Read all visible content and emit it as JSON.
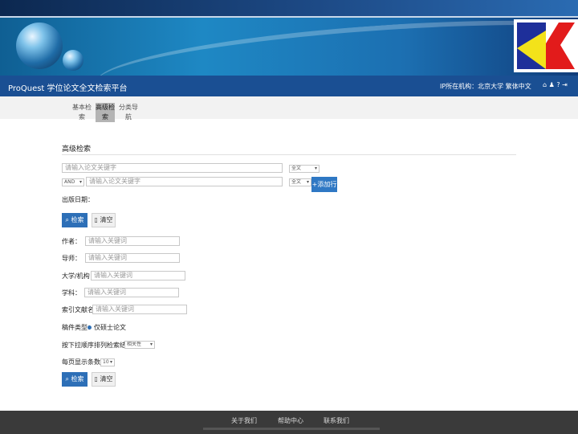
{
  "header": {
    "title": "ProQuest 学位论文全文检索平台",
    "institution": "IP所在机构：北京大学 繁体中文",
    "icons": [
      "home-icon",
      "user-icon",
      "help-icon",
      "exit-icon"
    ]
  },
  "tabs": [
    {
      "label": "基本检索",
      "active": false
    },
    {
      "label": "高级检索",
      "active": true
    },
    {
      "label": "分类导航",
      "active": false
    }
  ],
  "form": {
    "heading": "高级检索",
    "row1": {
      "placeholder": "请输入论文关键字",
      "field": "全文"
    },
    "row2": {
      "operator": "AND",
      "placeholder": "请输入论文关键字",
      "field": "全文"
    },
    "add_label": "+添加行",
    "pubdate_label": "出版日期：",
    "search_label": "检索",
    "clear_label": "清空",
    "fields": [
      {
        "label": "作者：",
        "placeholder": "请输入关键词"
      },
      {
        "label": "导师：",
        "placeholder": "请输入关键词"
      },
      {
        "label": "大学/机构：",
        "placeholder": "请输入关键词"
      },
      {
        "label": "学科：",
        "placeholder": "请输入关键词"
      },
      {
        "label": "索引文献名：",
        "placeholder": "请输入关键词"
      }
    ],
    "manuscript_label": "稿件类型：",
    "manuscript_option": "仅硕士论文",
    "sort_label": "按下拉顺序排列检索结果：",
    "sort_value": "相关性",
    "perpage_label": "每页显示条数：",
    "perpage_value": "10",
    "search2_label": "检索",
    "clear2_label": "清空"
  },
  "footer": {
    "links": [
      "关于我们",
      "帮助中心",
      "联系我们"
    ]
  }
}
